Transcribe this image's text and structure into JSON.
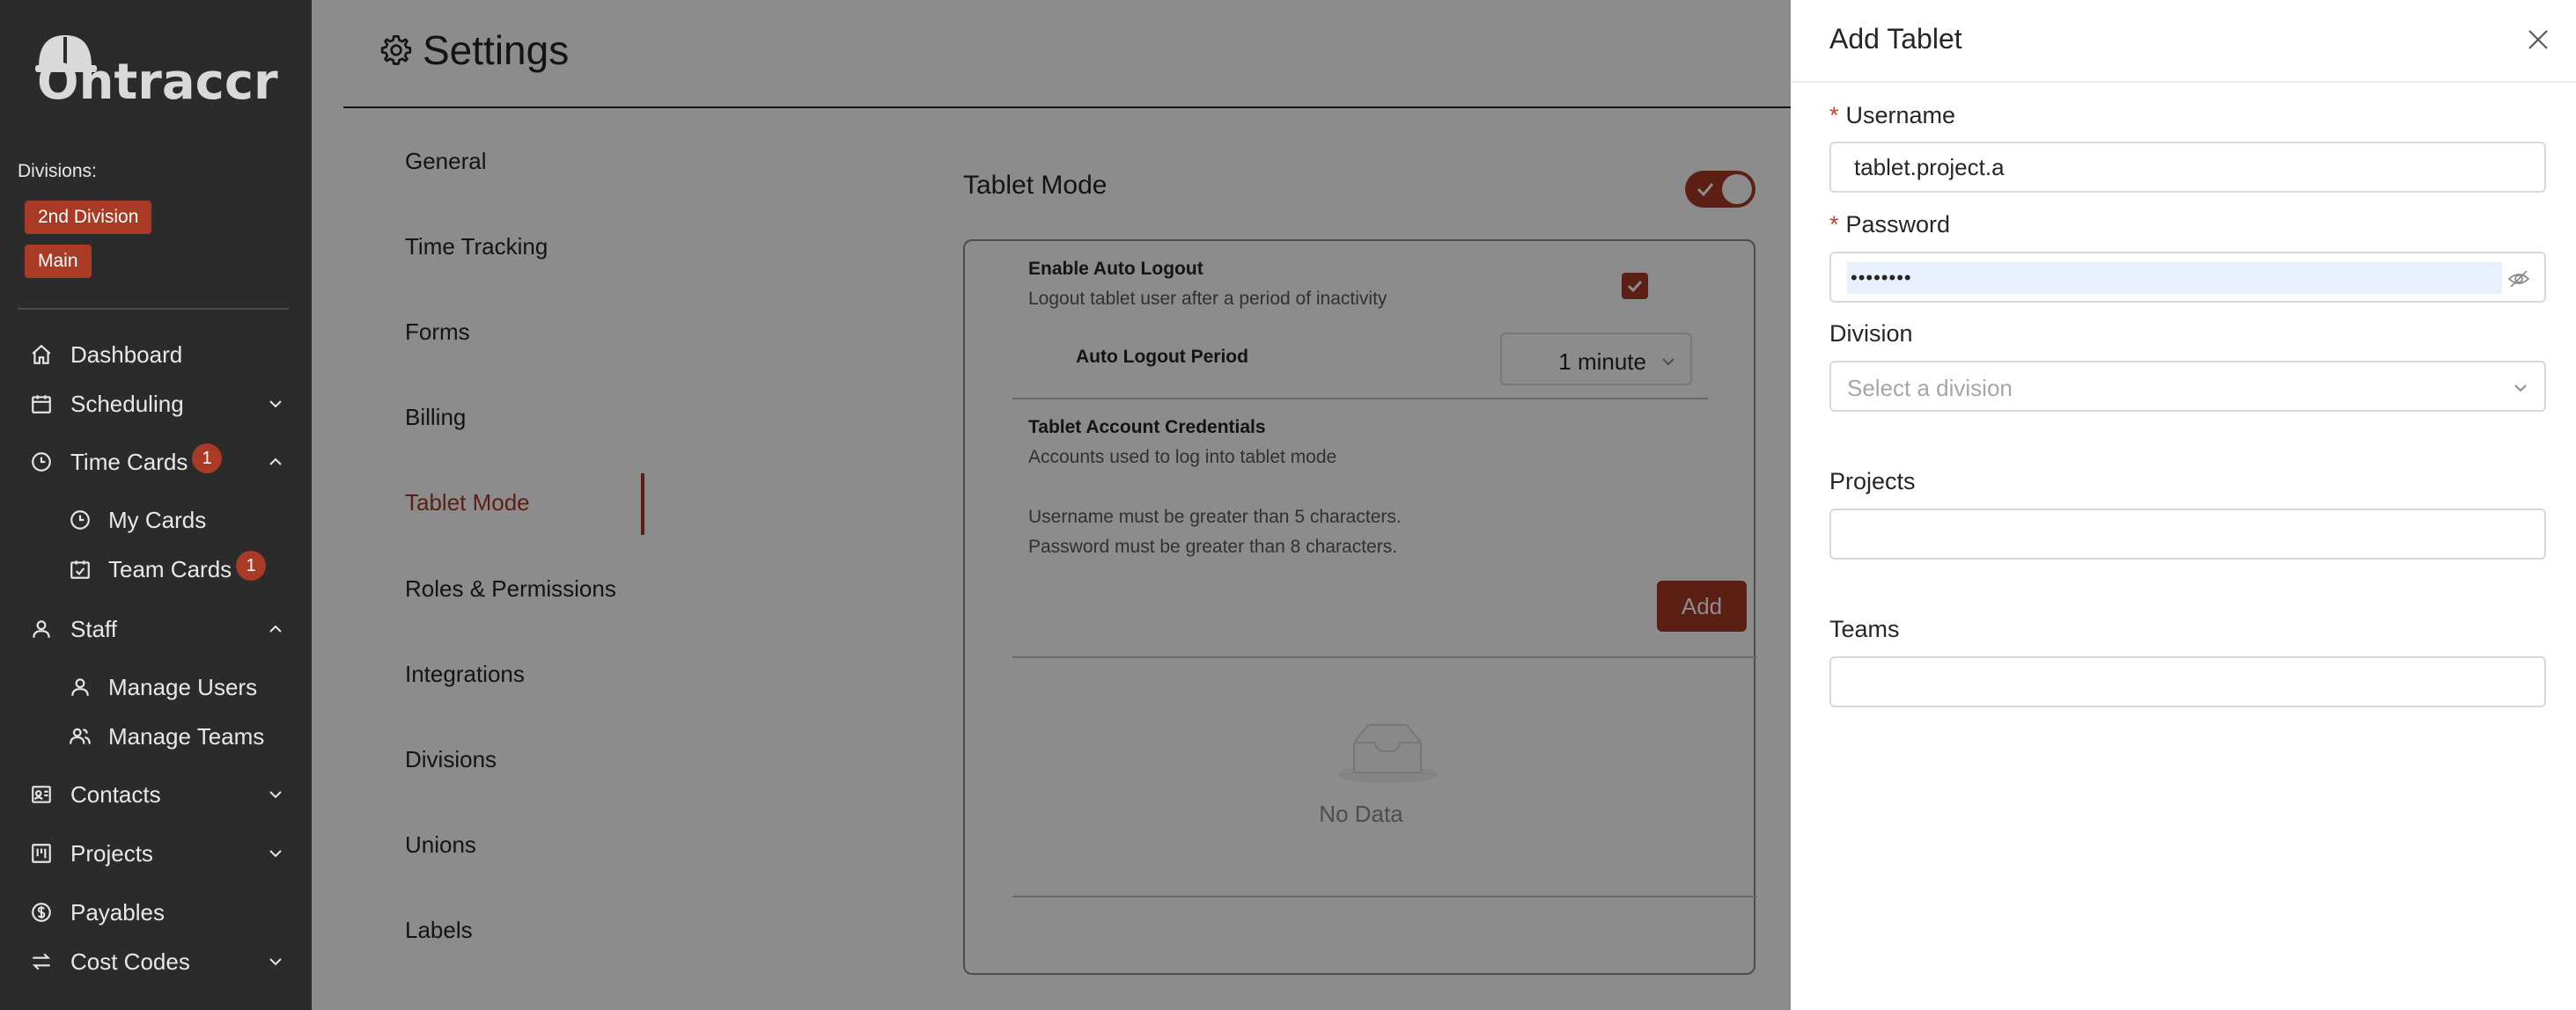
{
  "sidebar": {
    "logo_text": "Ontraccr",
    "divisions_label": "Divisions:",
    "division_tags": [
      "2nd Division",
      "Main"
    ],
    "nav": {
      "dashboard": "Dashboard",
      "scheduling": "Scheduling",
      "time_cards": "Time Cards",
      "time_cards_badge": "1",
      "my_cards": "My Cards",
      "team_cards": "Team Cards",
      "team_cards_badge": "1",
      "staff": "Staff",
      "manage_users": "Manage Users",
      "manage_teams": "Manage Teams",
      "contacts": "Contacts",
      "projects": "Projects",
      "payables": "Payables",
      "cost_codes": "Cost Codes"
    }
  },
  "header": {
    "title": "Settings"
  },
  "settings_nav": [
    "General",
    "Time Tracking",
    "Forms",
    "Billing",
    "Tablet Mode",
    "Roles & Permissions",
    "Integrations",
    "Divisions",
    "Unions",
    "Labels"
  ],
  "tablet_mode": {
    "title": "Tablet Mode",
    "enabled": true,
    "auto_logout_title": "Enable Auto Logout",
    "auto_logout_desc": "Logout tablet user after a period of inactivity",
    "auto_logout_checked": true,
    "period_label": "Auto Logout Period",
    "period_value": "1 minute",
    "credentials_title": "Tablet Account Credentials",
    "credentials_desc": "Accounts used to log into tablet mode",
    "username_rule": "Username must be greater than 5 characters.",
    "password_rule": "Password must be greater than 8 characters.",
    "add_label": "Add",
    "empty_text": "No Data"
  },
  "drawer": {
    "title": "Add Tablet",
    "username_label": "Username",
    "username_value": "tablet.project.a",
    "password_label": "Password",
    "password_masked": "••••••••",
    "division_label": "Division",
    "division_placeholder": "Select a division",
    "projects_label": "Projects",
    "teams_label": "Teams"
  },
  "colors": {
    "accent": "#a83a26",
    "sidebar_bg": "#2b2b2b"
  }
}
